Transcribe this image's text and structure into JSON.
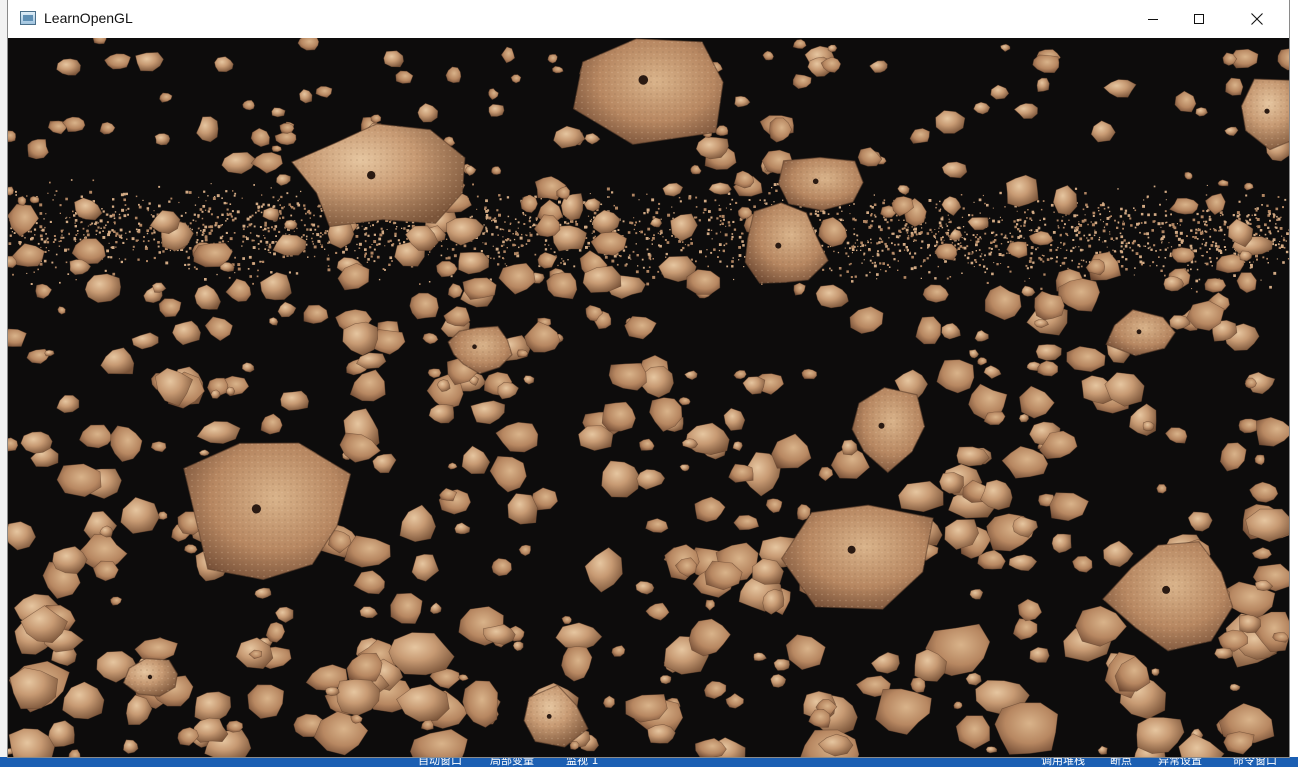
{
  "window": {
    "title": "LearnOpenGL",
    "icon": "app-window-icon",
    "controls": [
      {
        "name": "minimize-icon"
      },
      {
        "name": "maximize-icon"
      },
      {
        "name": "close-icon"
      }
    ]
  },
  "scene": {
    "description_hidden": false,
    "background_color": "#0d0c0c",
    "rock_base_color": "#c79a73",
    "rock_highlight_color": "#e2c09a",
    "rock_shadow_color": "#7a5439"
  },
  "ide_background": {
    "bottom_bar_items": [
      "自动窗口",
      "局部变量",
      "监视 1",
      "调用堆栈",
      "断点",
      "异常设置",
      "命令窗口"
    ],
    "bottom_bar_color": "#1b5fb3"
  }
}
